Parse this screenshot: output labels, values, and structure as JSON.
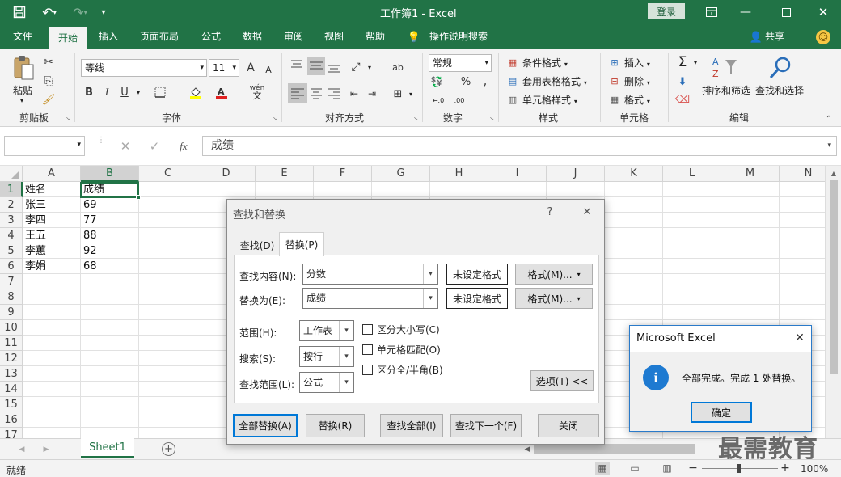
{
  "title": {
    "app": "工作簿1 - Excel",
    "login": "登录"
  },
  "menu": {
    "file": "文件",
    "home": "开始",
    "insert": "插入",
    "layout": "页面布局",
    "formulas": "公式",
    "data": "数据",
    "review": "审阅",
    "view": "视图",
    "help": "帮助",
    "tellme": "操作说明搜索",
    "share": "共享"
  },
  "ribbon": {
    "clipboard": {
      "paste": "粘贴",
      "label": "剪贴板"
    },
    "font": {
      "name": "等线",
      "size": "11",
      "bold": "B",
      "italic": "I",
      "underline": "U",
      "grow": "A",
      "shrink": "A",
      "label": "字体",
      "wen": "wén",
      "wenchar": "文"
    },
    "align": {
      "label": "对齐方式",
      "wrap": "ab"
    },
    "number": {
      "format": "常规",
      "percent": "%",
      "comma": ",",
      "inc": "←.0",
      "dec": ".00",
      "label": "数字"
    },
    "styles": {
      "cond": "条件格式",
      "table": "套用表格格式",
      "cell": "单元格样式",
      "label": "样式"
    },
    "cells": {
      "insert": "插入",
      "delete": "删除",
      "format": "格式",
      "label": "单元格"
    },
    "editing": {
      "sort": "排序和筛选",
      "find": "查找和选择",
      "label": "编辑",
      "sigma": "Σ"
    }
  },
  "formula": {
    "value": "成绩",
    "fx": "fx"
  },
  "columns": [
    "A",
    "B",
    "C",
    "D",
    "E",
    "F",
    "G",
    "H",
    "I",
    "J",
    "K",
    "L",
    "M",
    "N"
  ],
  "rows": [
    "1",
    "2",
    "3",
    "4",
    "5",
    "6",
    "7",
    "8",
    "9",
    "10",
    "11",
    "12",
    "13",
    "14",
    "15",
    "16",
    "17"
  ],
  "cells": {
    "a1": "姓名",
    "b1": "成绩",
    "a2": "张三",
    "b2": "69",
    "a3": "李四",
    "b3": "77",
    "a4": "王五",
    "b4": "88",
    "a5": "李蕙",
    "b5": "92",
    "a6": "李娟",
    "b6": "68"
  },
  "sheet": {
    "tab": "Sheet1",
    "add": "+"
  },
  "status": {
    "ready": "就绪",
    "zoom": "100%",
    "minus": "−",
    "plus": "+"
  },
  "dialog": {
    "title": "查找和替换",
    "help": "?",
    "close": "✕",
    "tab_find": "查找(D)",
    "tab_replace": "替换(P)",
    "find_label": "查找内容(N):",
    "find_value": "分数",
    "replace_label": "替换为(E):",
    "replace_value": "成绩",
    "noformat1": "未设定格式",
    "noformat2": "未设定格式",
    "format1": "格式(M)...",
    "format2": "格式(M)...",
    "scope_label": "范围(H):",
    "scope_value": "工作表",
    "search_label": "搜索(S):",
    "search_value": "按行",
    "lookin_label": "查找范围(L):",
    "lookin_value": "公式",
    "case": "区分大小写(C)",
    "whole": "单元格匹配(O)",
    "width": "区分全/半角(B)",
    "options": "选项(T) <<",
    "replace_all": "全部替换(A)",
    "replace": "替换(R)",
    "find_all": "查找全部(I)",
    "find_next": "查找下一个(F)",
    "close_btn": "关闭"
  },
  "message": {
    "title": "Microsoft Excel",
    "close": "✕",
    "icon": "i",
    "text": "全部完成。完成 1 处替换。",
    "ok": "确定"
  },
  "watermark": "最需教育",
  "colors": {
    "brand": "#217346",
    "selection": "#217346",
    "info": "#1e7ad1"
  }
}
